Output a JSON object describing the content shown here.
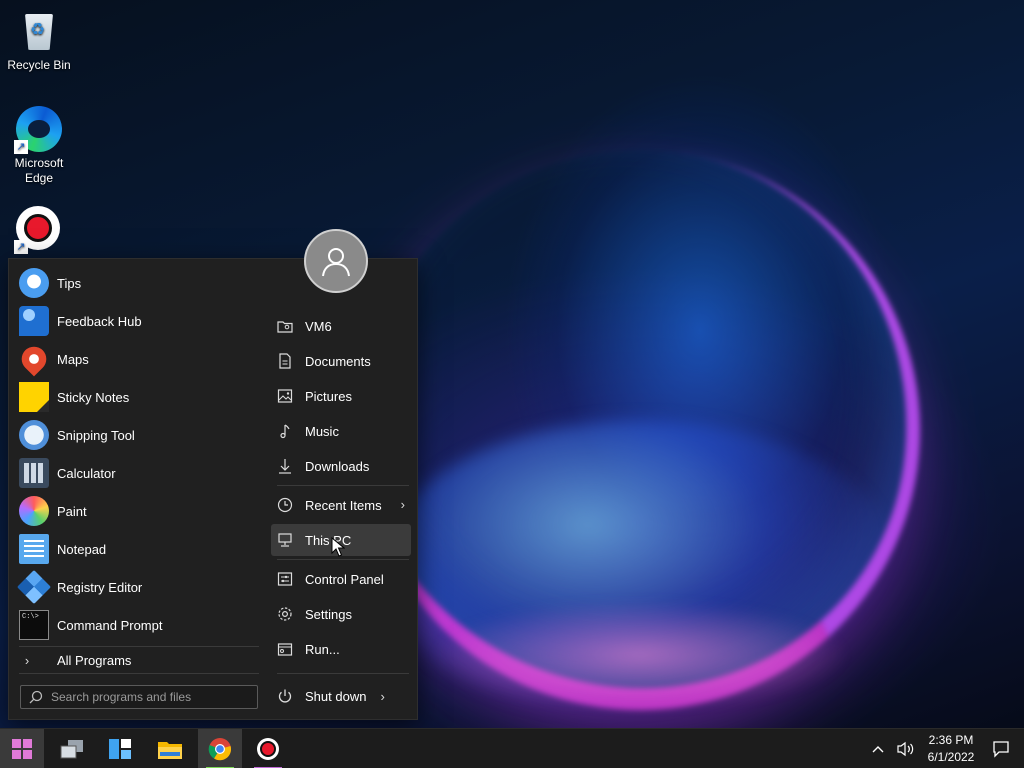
{
  "desktop": {
    "icons": [
      {
        "label": "Recycle Bin",
        "icon": "recycle-bin-icon"
      },
      {
        "label": "Microsoft Edge",
        "icon": "edge-icon"
      },
      {
        "label": "",
        "icon": "screen-recorder-icon"
      }
    ]
  },
  "start_menu": {
    "apps": [
      {
        "label": "Tips",
        "icon": "tips-icon"
      },
      {
        "label": "Feedback Hub",
        "icon": "feedback-hub-icon"
      },
      {
        "label": "Maps",
        "icon": "maps-icon"
      },
      {
        "label": "Sticky Notes",
        "icon": "sticky-notes-icon"
      },
      {
        "label": "Snipping Tool",
        "icon": "snipping-tool-icon"
      },
      {
        "label": "Calculator",
        "icon": "calculator-icon"
      },
      {
        "label": "Paint",
        "icon": "paint-icon"
      },
      {
        "label": "Notepad",
        "icon": "notepad-icon"
      },
      {
        "label": "Registry Editor",
        "icon": "registry-editor-icon"
      },
      {
        "label": "Command Prompt",
        "icon": "command-prompt-icon"
      }
    ],
    "all_programs_label": "All Programs",
    "search_placeholder": "Search programs and files",
    "places": [
      {
        "label": "VM6",
        "icon": "user-folder-icon"
      },
      {
        "label": "Documents",
        "icon": "document-icon"
      },
      {
        "label": "Pictures",
        "icon": "picture-icon"
      },
      {
        "label": "Music",
        "icon": "music-note-icon"
      },
      {
        "label": "Downloads",
        "icon": "download-icon"
      },
      {
        "label": "Recent Items",
        "icon": "clock-icon"
      },
      {
        "label": "This PC",
        "icon": "computer-icon"
      },
      {
        "label": "Control Panel",
        "icon": "control-panel-icon"
      },
      {
        "label": "Settings",
        "icon": "gear-icon"
      },
      {
        "label": "Run...",
        "icon": "run-icon"
      }
    ],
    "hovered_place": "This PC",
    "shutdown_label": "Shut down"
  },
  "taskbar": {
    "apps": [
      {
        "name": "start",
        "icon": "windows-start-icon",
        "active": true
      },
      {
        "name": "task-view",
        "icon": "task-view-icon",
        "active": false
      },
      {
        "name": "widgets",
        "icon": "widgets-icon",
        "active": false
      },
      {
        "name": "file-explorer",
        "icon": "file-explorer-icon",
        "active": false
      },
      {
        "name": "chrome",
        "icon": "chrome-icon",
        "active": true
      },
      {
        "name": "screen-recorder",
        "icon": "screen-recorder-icon",
        "active": false
      }
    ],
    "clock": {
      "time": "2:36 PM",
      "date": "6/1/2022"
    }
  },
  "colors": {
    "start_menu_bg": "#202020",
    "taskbar_bg": "#1c1c1c",
    "hover_bg": "#3b3b3b",
    "start_accent": "#e07ad8",
    "chrome_underline": "#7ed957"
  }
}
